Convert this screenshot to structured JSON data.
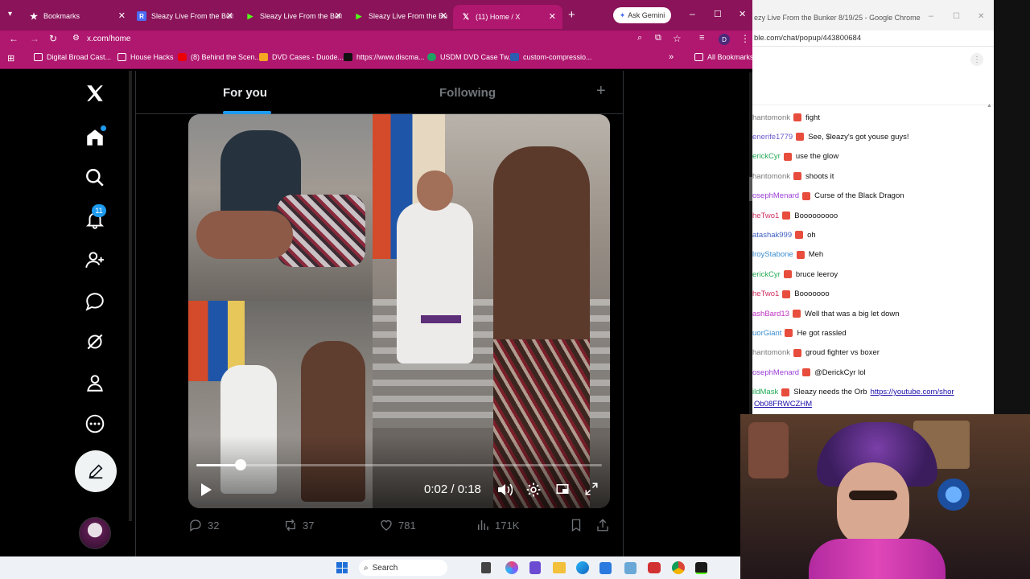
{
  "browser": {
    "tabs": [
      {
        "label": "Bookmarks",
        "icon": "star-icon"
      },
      {
        "label": "Sleazy Live From the Bun",
        "icon": "r-icon"
      },
      {
        "label": "Sleazy Live From the Bun",
        "icon": "play-icon"
      },
      {
        "label": "Sleazy Live From the Bun",
        "icon": "play-icon"
      },
      {
        "label": "(11) Home / X",
        "icon": "x-icon"
      }
    ],
    "ask_gemini": "Ask Gemini",
    "url": "x.com/home",
    "bookmarks": [
      "Digital Broad Cast...",
      "House Hacks",
      "(8) Behind the Scen...",
      "DVD Cases - Duode...",
      "https://www.discma...",
      "USDM DVD Case Tw...",
      "custom-compressio..."
    ],
    "all_bookmarks": "All Bookmarks",
    "profile_initial": "D"
  },
  "x": {
    "notification_count": "11",
    "tabs": {
      "for_you": "For you",
      "following": "Following"
    },
    "video": {
      "time": "0:02 / 0:18",
      "progress": 0.11
    },
    "actions": {
      "replies": "32",
      "reposts": "37",
      "likes": "781",
      "views": "171K"
    }
  },
  "chat": {
    "title": "ezy Live From the Bunker 8/19/25 - Google Chrome",
    "url": "ble.com/chat/popup/443800684",
    "messages": [
      {
        "user": "hantomonk",
        "text": "fight",
        "color": "#7a7a7a"
      },
      {
        "user": "enerife1779",
        "text": "See, $leazy's got youse guys!",
        "color": "#6a5acd"
      },
      {
        "user": "erickCyr",
        "text": "use the glow",
        "color": "#22aa55"
      },
      {
        "user": "hantomonk",
        "text": "shoots it",
        "color": "#7a7a7a"
      },
      {
        "user": "osephMenard",
        "text": "Curse of the Black Dragon",
        "color": "#9b3fd6"
      },
      {
        "user": "heTwo1",
        "text": "Booooooooo",
        "color": "#d03060"
      },
      {
        "user": "atashak999",
        "text": "oh",
        "color": "#4060c0"
      },
      {
        "user": "lroyStabone",
        "text": "Meh",
        "color": "#3b8ed0"
      },
      {
        "user": "erickCyr",
        "text": "bruce leeroy",
        "color": "#22aa55"
      },
      {
        "user": "heTwo1",
        "text": "Booooooo",
        "color": "#d03060"
      },
      {
        "user": "ashBard13",
        "text": "Well that was a big let down",
        "color": "#c030c0"
      },
      {
        "user": "uorGiant",
        "text": "He got rassled",
        "color": "#3b8ed0"
      },
      {
        "user": "hantomonk",
        "text": "groud fighter vs boxer",
        "color": "#7a7a7a"
      },
      {
        "user": "osephMenard",
        "text": "@DerickCyr lol",
        "color": "#9b3fd6"
      },
      {
        "user": "ildMask",
        "text": "Sleazy needs the Orb",
        "color": "#22aa55"
      }
    ],
    "link_line1": "https://youtube.com/shor",
    "link_line2": "Ob08FRWCZHM"
  },
  "taskbar": {
    "search": "Search"
  }
}
